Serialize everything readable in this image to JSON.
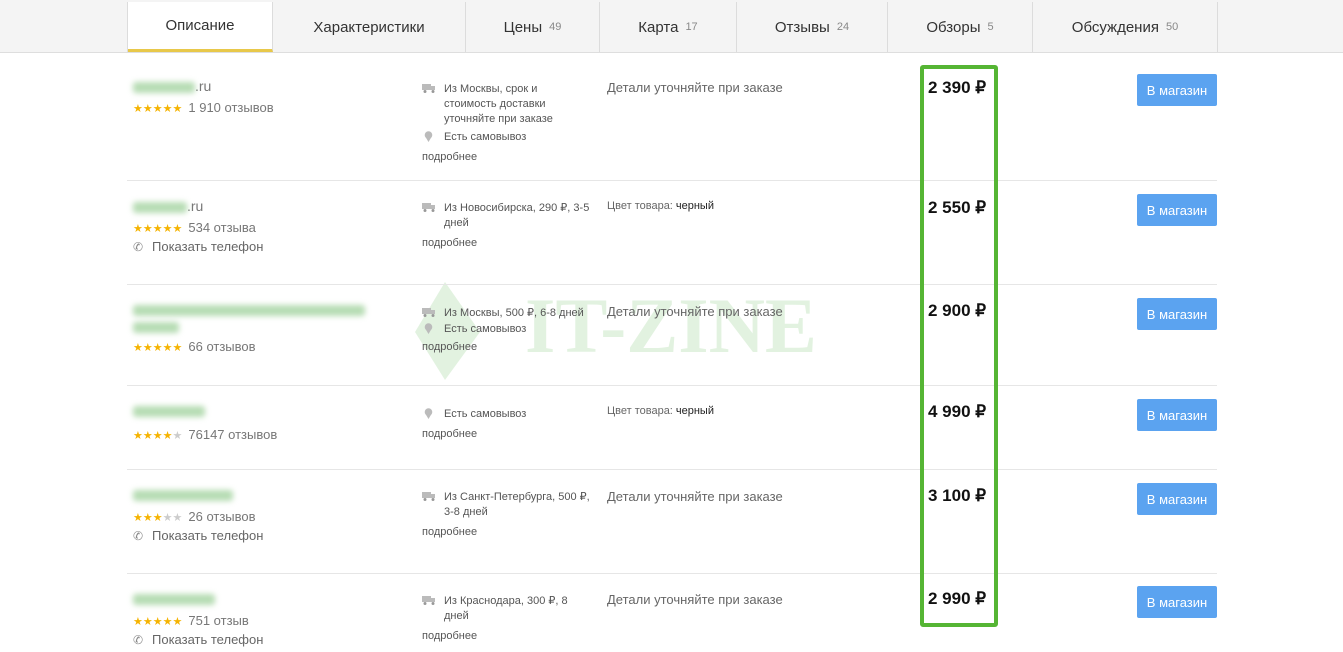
{
  "tabs": [
    {
      "label": "Описание",
      "count": "",
      "active": true
    },
    {
      "label": "Характеристики",
      "count": ""
    },
    {
      "label": "Цены",
      "count": "49"
    },
    {
      "label": "Карта",
      "count": "17"
    },
    {
      "label": "Отзывы",
      "count": "24"
    },
    {
      "label": "Обзоры",
      "count": "5"
    },
    {
      "label": "Обсуждения",
      "count": "50"
    }
  ],
  "offers": [
    {
      "shop_suffix": ".ru",
      "stars": 5,
      "reviews": "1 910 отзывов",
      "delivery": [
        "Из Москвы, срок и стоимость доставки уточняйте при заказе"
      ],
      "pickup": "Есть самовывоз",
      "more": "подробнее",
      "details": "Детали уточняйте при заказе",
      "price": "2 390 ₽",
      "button": "В магазин"
    },
    {
      "shop_suffix": ".ru",
      "stars": 5,
      "reviews": "534 отзыва",
      "phone": "Показать телефон",
      "delivery": [
        "Из Новосибирска, 290 ₽, 3-5 дней"
      ],
      "more": "подробнее",
      "color_label": "Цвет товара:",
      "color_value": "черный",
      "price": "2 550 ₽",
      "button": "В магазин"
    },
    {
      "shop_suffix": "",
      "stars": 5,
      "reviews": "66 отзывов",
      "delivery": [
        "Из Москвы, 500 ₽, 6-8 дней"
      ],
      "pickup": "Есть самовывоз",
      "more": "подробнее",
      "details": "Детали уточняйте при заказе",
      "price": "2 900 ₽",
      "button": "В магазин"
    },
    {
      "shop_suffix": "",
      "stars": 4,
      "reviews": "76147 отзывов",
      "pickup": "Есть самовывоз",
      "more": "подробнее",
      "color_label": "Цвет товара:",
      "color_value": "черный",
      "price": "4 990 ₽",
      "button": "В магазин"
    },
    {
      "shop_suffix": "",
      "stars": 3,
      "reviews": "26 отзывов",
      "phone": "Показать телефон",
      "delivery": [
        "Из Санкт-Петербурга, 500 ₽, 3-8 дней"
      ],
      "more": "подробнее",
      "details": "Детали уточняйте при заказе",
      "price": "3 100 ₽",
      "button": "В магазин"
    },
    {
      "shop_suffix": "",
      "stars": 5,
      "reviews": "751 отзыв",
      "phone": "Показать телефон",
      "delivery": [
        "Из Краснодара, 300 ₽, 8 дней"
      ],
      "more": "подробнее",
      "details": "Детали уточняйте при заказе",
      "price": "2 990 ₽",
      "button": "В магазин"
    }
  ],
  "watermark": {
    "text": "IT-ZINE",
    "color": "#3aa82a"
  },
  "colors": {
    "accent_button": "#5ba3f0",
    "highlight": "#55b534",
    "active_tab_underline": "#e8c84a",
    "star": "#f5b301"
  }
}
